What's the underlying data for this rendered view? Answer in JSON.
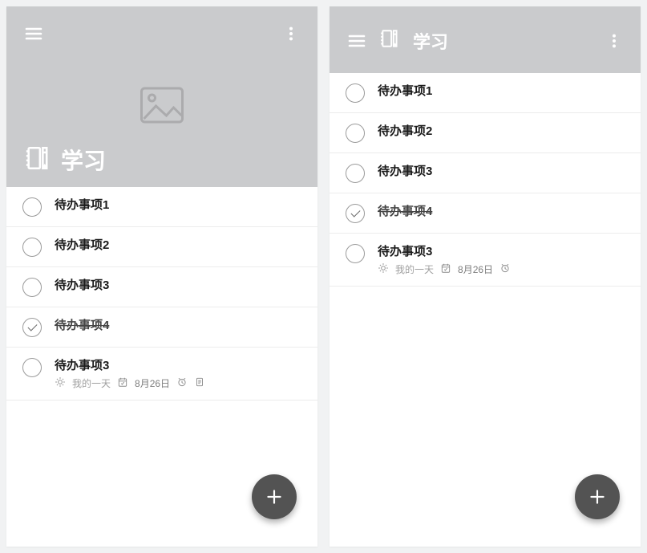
{
  "left": {
    "title": "学习",
    "items": [
      {
        "title": "待办事项1",
        "done": false
      },
      {
        "title": "待办事项2",
        "done": false
      },
      {
        "title": "待办事项3",
        "done": false
      },
      {
        "title": "待办事项4",
        "done": true
      },
      {
        "title": "待办事项3",
        "done": false,
        "meta": {
          "myDay": "我的一天",
          "date": "8月26日",
          "showAlarm": true,
          "showNote": true
        }
      }
    ]
  },
  "right": {
    "title": "学习",
    "items": [
      {
        "title": "待办事项1",
        "done": false
      },
      {
        "title": "待办事项2",
        "done": false
      },
      {
        "title": "待办事项3",
        "done": false
      },
      {
        "title": "待办事项4",
        "done": true
      },
      {
        "title": "待办事项3",
        "done": false,
        "meta": {
          "myDay": "我的一天",
          "date": "8月26日",
          "showAlarm": true
        }
      }
    ]
  },
  "colors": {
    "headerBg": "#cacbcd",
    "fab": "#535353"
  }
}
